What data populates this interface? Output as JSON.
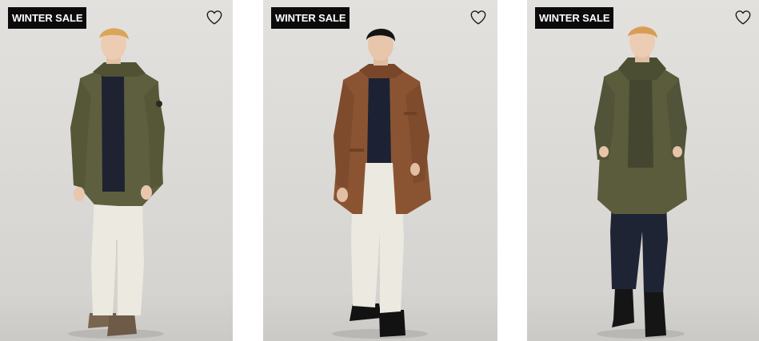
{
  "products": [
    {
      "badge": "WINTER SALE",
      "wishlist_icon": "heart-outline-icon",
      "image": "model-olive-parka-white-trousers"
    },
    {
      "badge": "WINTER SALE",
      "wishlist_icon": "heart-outline-icon",
      "image": "model-brown-coat-white-trousers"
    },
    {
      "badge": "WINTER SALE",
      "wishlist_icon": "heart-outline-icon",
      "image": "model-olive-coat-navy-trousers"
    }
  ],
  "colors": {
    "badge_bg": "#0b0b0b",
    "badge_text": "#ffffff",
    "background": "#dedcd9",
    "olive": "#5e5f3f",
    "brown": "#8a5433",
    "cream": "#ece9e0",
    "navy": "#1e2233"
  }
}
